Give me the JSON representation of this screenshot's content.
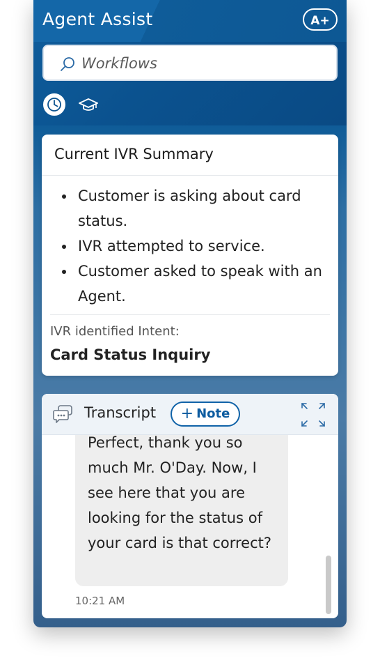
{
  "header": {
    "title": "Agent Assist",
    "badge": "A+"
  },
  "search": {
    "placeholder": "Workflows"
  },
  "tabs": [
    {
      "name": "history",
      "icon": "clock-icon",
      "active": true
    },
    {
      "name": "learning",
      "icon": "graduation-cap-icon",
      "active": false
    }
  ],
  "ivr_summary": {
    "title": "Current IVR Summary",
    "bullets": [
      "Customer is asking about card status.",
      "IVR attempted to service.",
      "Customer asked to speak with an Agent."
    ],
    "intent_label": "IVR identified Intent:",
    "intent_value": "Card Status Inquiry"
  },
  "transcript": {
    "title": "Transcript",
    "note_button": "Note",
    "message": {
      "text": "Perfect, thank you so much Mr. O'Day. Now, I see here that you are looking for the status of your card is that correct?",
      "time": "10:21 AM"
    }
  },
  "colors": {
    "brand_blue": "#0b528f",
    "accent_blue": "#1163a8"
  }
}
